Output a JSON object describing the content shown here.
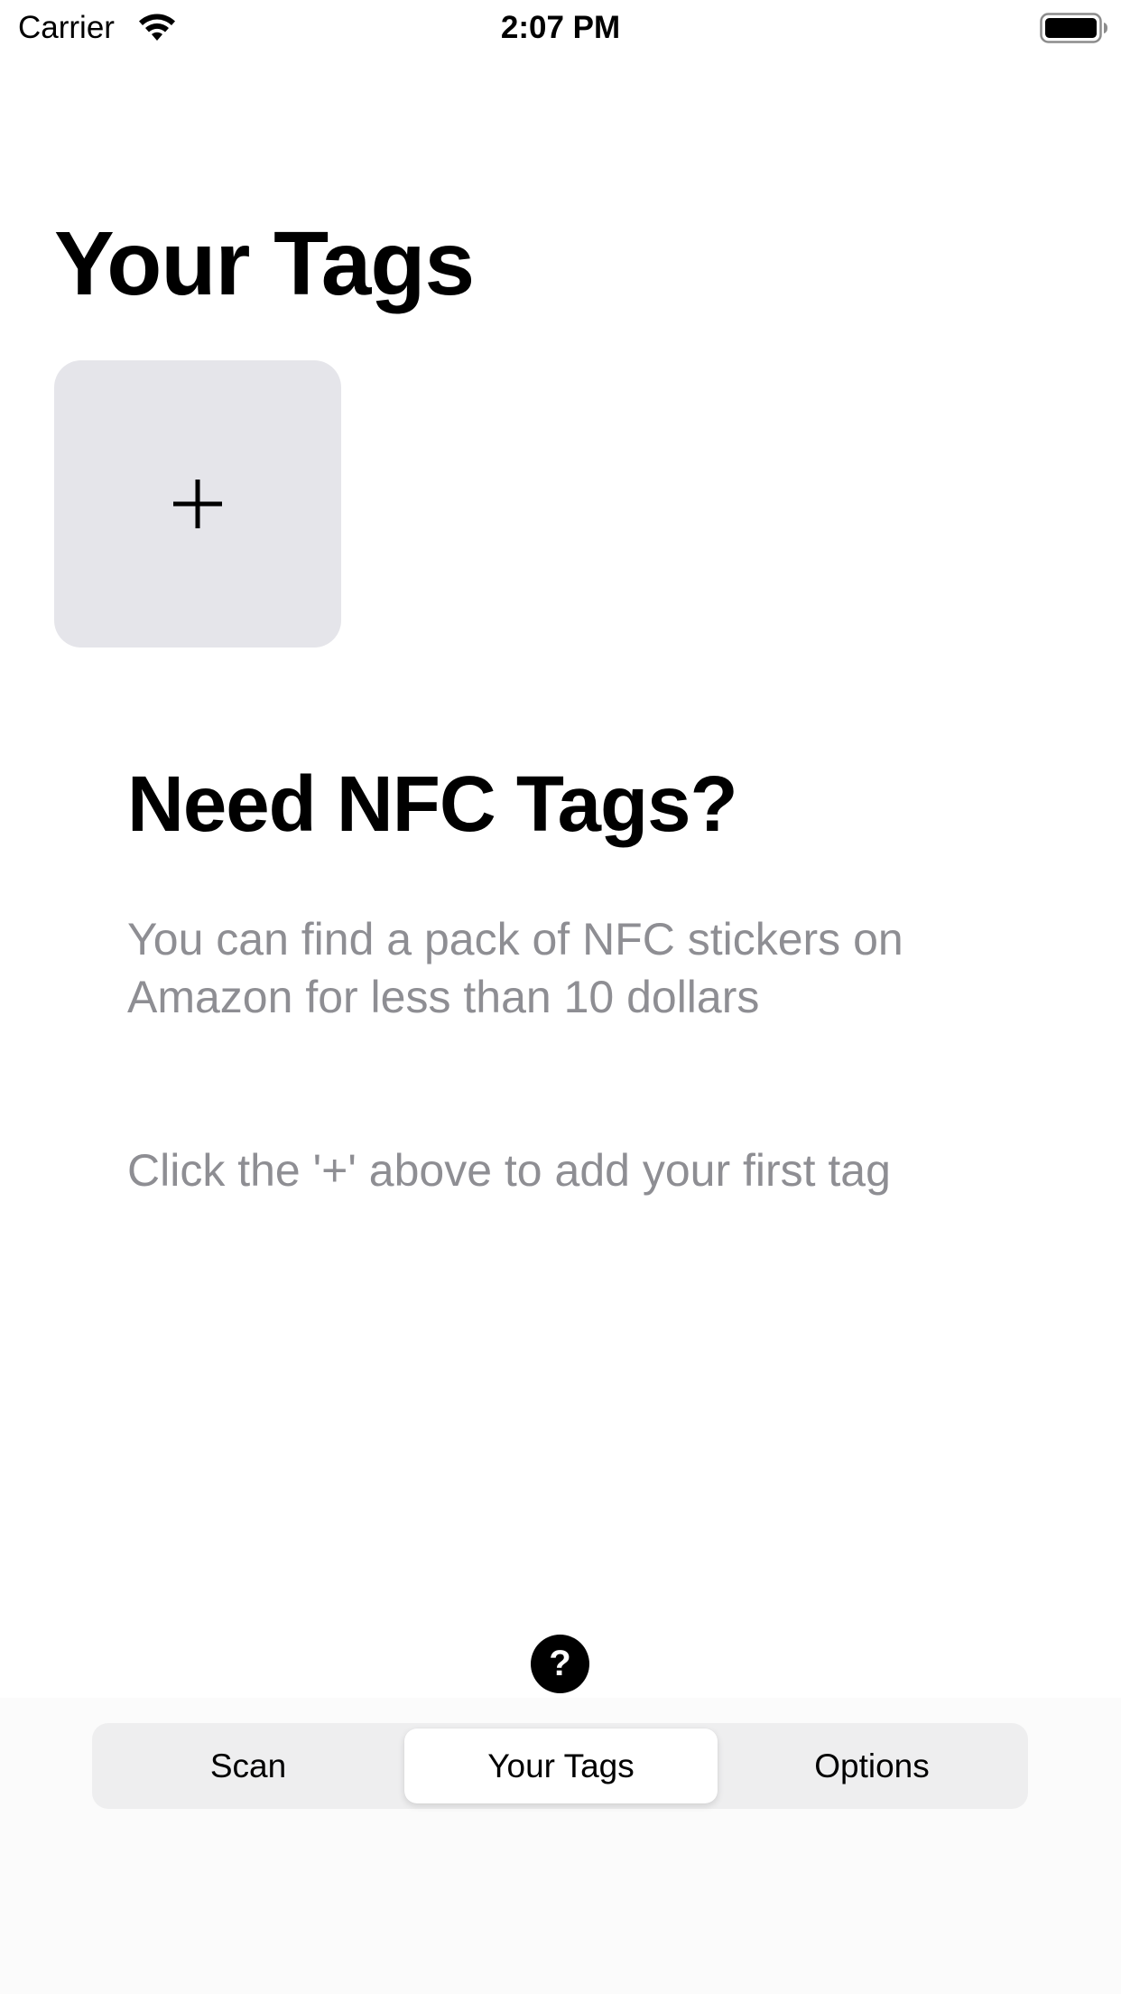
{
  "status_bar": {
    "carrier": "Carrier",
    "time": "2:07 PM",
    "icons": [
      "wifi-icon",
      "battery-icon"
    ]
  },
  "page": {
    "title": "Your Tags"
  },
  "add_tile": {
    "icon": "plus-icon"
  },
  "promo": {
    "heading": "Need NFC Tags?",
    "body_line1": "You can find a pack of NFC stickers on",
    "body_line2": "Amazon for less than 10 dollars",
    "hint": "Click the '+' above to add your first tag"
  },
  "help": {
    "label": "?"
  },
  "tabs": {
    "items": [
      {
        "label": "Scan",
        "selected": false
      },
      {
        "label": "Your Tags",
        "selected": true
      },
      {
        "label": "Options",
        "selected": false
      }
    ]
  },
  "colors": {
    "background": "#ffffff",
    "tile": "#e5e5ea",
    "secondary_text": "#8e8e93",
    "segment_track": "#eeeeef",
    "segment_selected": "#ffffff"
  }
}
